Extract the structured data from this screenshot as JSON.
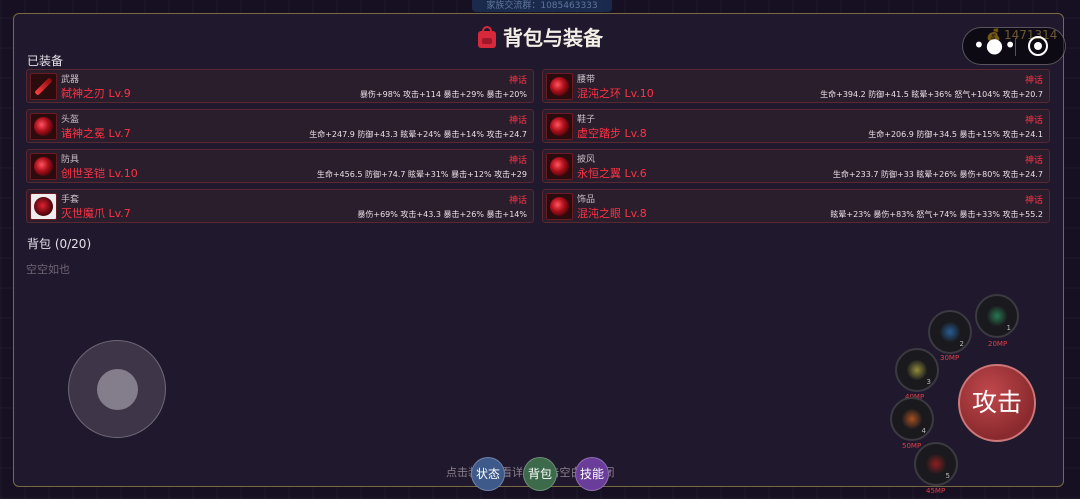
{
  "top_strip_text": "家族交流群：1085463333",
  "title": "背包与装备",
  "gold": "1471314",
  "equipped_label": "已装备",
  "backpack_label": "背包 (0/20)",
  "empty_text": "空空如也",
  "equipment": [
    {
      "type": "武器",
      "name": "弑神之刃 Lv.9",
      "rarity": "神话",
      "stats": "暴伤+98% 攻击+114 暴击+29% 暴击+20%",
      "icon": "blade-icon"
    },
    {
      "type": "腰带",
      "name": "混沌之环 Lv.10",
      "rarity": "神话",
      "stats": "生命+394.2 防御+41.5 眩晕+36% 怒气+104% 攻击+20.7",
      "icon": "belt-icon"
    },
    {
      "type": "头盔",
      "name": "诸神之冕 Lv.7",
      "rarity": "神话",
      "stats": "生命+247.9 防御+43.3 眩晕+24% 暴击+14% 攻击+24.7",
      "icon": "helmet-icon"
    },
    {
      "type": "鞋子",
      "name": "虚空踏步 Lv.8",
      "rarity": "神话",
      "stats": "生命+206.9 防御+34.5 暴击+15% 攻击+24.1",
      "icon": "boots-icon"
    },
    {
      "type": "防具",
      "name": "创世圣铠 Lv.10",
      "rarity": "神话",
      "stats": "生命+456.5 防御+74.7 眩晕+31% 暴击+12% 攻击+29",
      "icon": "armor-icon"
    },
    {
      "type": "披风",
      "name": "永恒之翼 Lv.6",
      "rarity": "神话",
      "stats": "生命+233.7 防御+33 眩晕+26% 暴伤+80% 攻击+24.7",
      "icon": "cape-icon"
    },
    {
      "type": "手套",
      "name": "灭世魔爪 Lv.7",
      "rarity": "神话",
      "stats": "暴伤+69% 攻击+43.3 暴击+26% 暴击+14%",
      "icon": "gloves-icon"
    },
    {
      "type": "饰品",
      "name": "混沌之眼 Lv.8",
      "rarity": "神话",
      "stats": "眩晕+23% 暴伤+83% 怒气+74% 暴击+33% 攻击+55.2",
      "icon": "accessory-icon"
    }
  ],
  "hint": "点击装备查看详情  点击空白处关闭",
  "tabs": [
    {
      "label": "状态",
      "color": "#3d5a8a"
    },
    {
      "label": "背包",
      "color": "#3c6a4a"
    },
    {
      "label": "技能",
      "color": "#6a3d9a"
    }
  ],
  "skills": [
    {
      "num": "1",
      "mp": "20MP",
      "color": "#2a8a5a"
    },
    {
      "num": "2",
      "mp": "30MP",
      "color": "#2a6aa8"
    },
    {
      "num": "3",
      "mp": "40MP",
      "color": "#a8a040"
    },
    {
      "num": "4",
      "mp": "50MP",
      "color": "#c05a20"
    },
    {
      "num": "5",
      "mp": "45MP",
      "color": "#a02020"
    }
  ],
  "attack_label": "攻击"
}
